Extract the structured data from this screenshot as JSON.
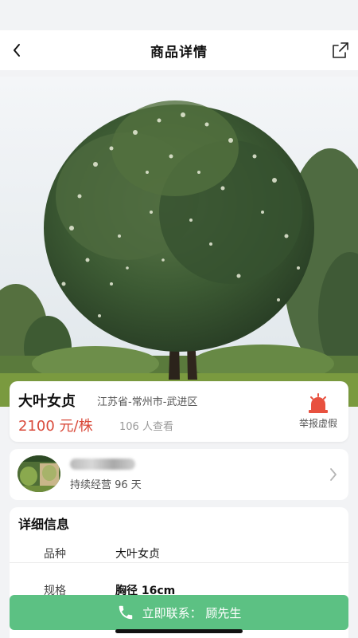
{
  "header": {
    "title": "商品详情",
    "back_icon": "chevron-left-icon",
    "share_icon": "share-icon"
  },
  "product": {
    "name": "大叶女贞",
    "location": "江苏省-常州市-武进区",
    "price": "2100 元/株",
    "views": "106 人查看",
    "report_label": "举报虚假",
    "report_icon": "siren-icon",
    "price_color": "#d94a3a",
    "report_color": "#e8513f"
  },
  "seller": {
    "duration": "持续经营 96 天",
    "arrow_icon": "chevron-right-icon"
  },
  "details": {
    "title": "详细信息",
    "rows": [
      {
        "key": "品种",
        "value": "大叶女贞"
      },
      {
        "key": "规格",
        "value": "胸径 16cm"
      }
    ]
  },
  "contact": {
    "label": "立即联系： 顾先生",
    "icon": "phone-icon",
    "color": "#5cc183"
  }
}
